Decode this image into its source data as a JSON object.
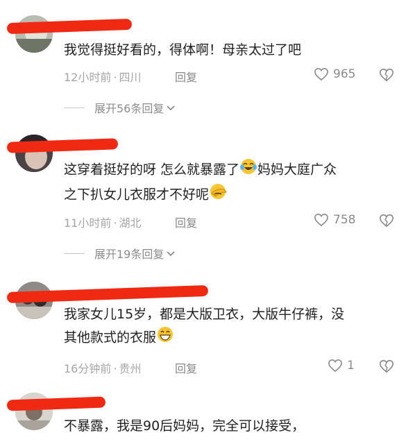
{
  "comments": [
    {
      "text": "我觉得挺好看的，得体啊！母亲太过了吧",
      "time": "12小时前",
      "location": "四川",
      "reply": "回复",
      "likes": "965",
      "expand": "展开56条回复"
    },
    {
      "line1": "这穿着挺好的呀 怎么就暴露了",
      "line1b": "妈妈大庭广众",
      "line2": "之下扒女儿衣服才不好呢",
      "time": "11小时前",
      "location": "湖北",
      "reply": "回复",
      "likes": "758",
      "expand": "展开19条回复"
    },
    {
      "line1": "我家女儿15岁，都是大版卫衣，大版牛仔裤，没",
      "line2": "其他款式的衣服",
      "time": "16分钟前",
      "location": "贵州",
      "reply": "回复",
      "likes": "1"
    },
    {
      "text": "不暴露，我是90后妈妈，完全可以接受，"
    }
  ],
  "icons": [
    "heart-icon",
    "dislike-heart-icon",
    "chevron-down-icon",
    "crying-laughing-emoji",
    "facepalm-emoji",
    "grinning-emoji"
  ]
}
